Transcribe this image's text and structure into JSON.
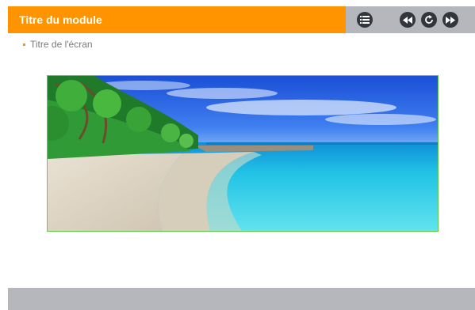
{
  "header": {
    "module_title": "Titre du module",
    "controls": [
      {
        "name": "menu",
        "icon": "menu-list-icon"
      },
      {
        "name": "previous",
        "icon": "rewind-icon"
      },
      {
        "name": "reload",
        "icon": "reload-icon"
      },
      {
        "name": "next",
        "icon": "fast-forward-icon"
      }
    ]
  },
  "screen": {
    "title": "Titre de l'écran"
  },
  "image": {
    "subject": "tropical beach with turquoise sea, white sand and palm trees"
  },
  "colors": {
    "accent": "#ff9400",
    "toolbar_gray": "#b5b7bc",
    "button_dark": "#33363b",
    "image_border": "#5fcf4c"
  }
}
